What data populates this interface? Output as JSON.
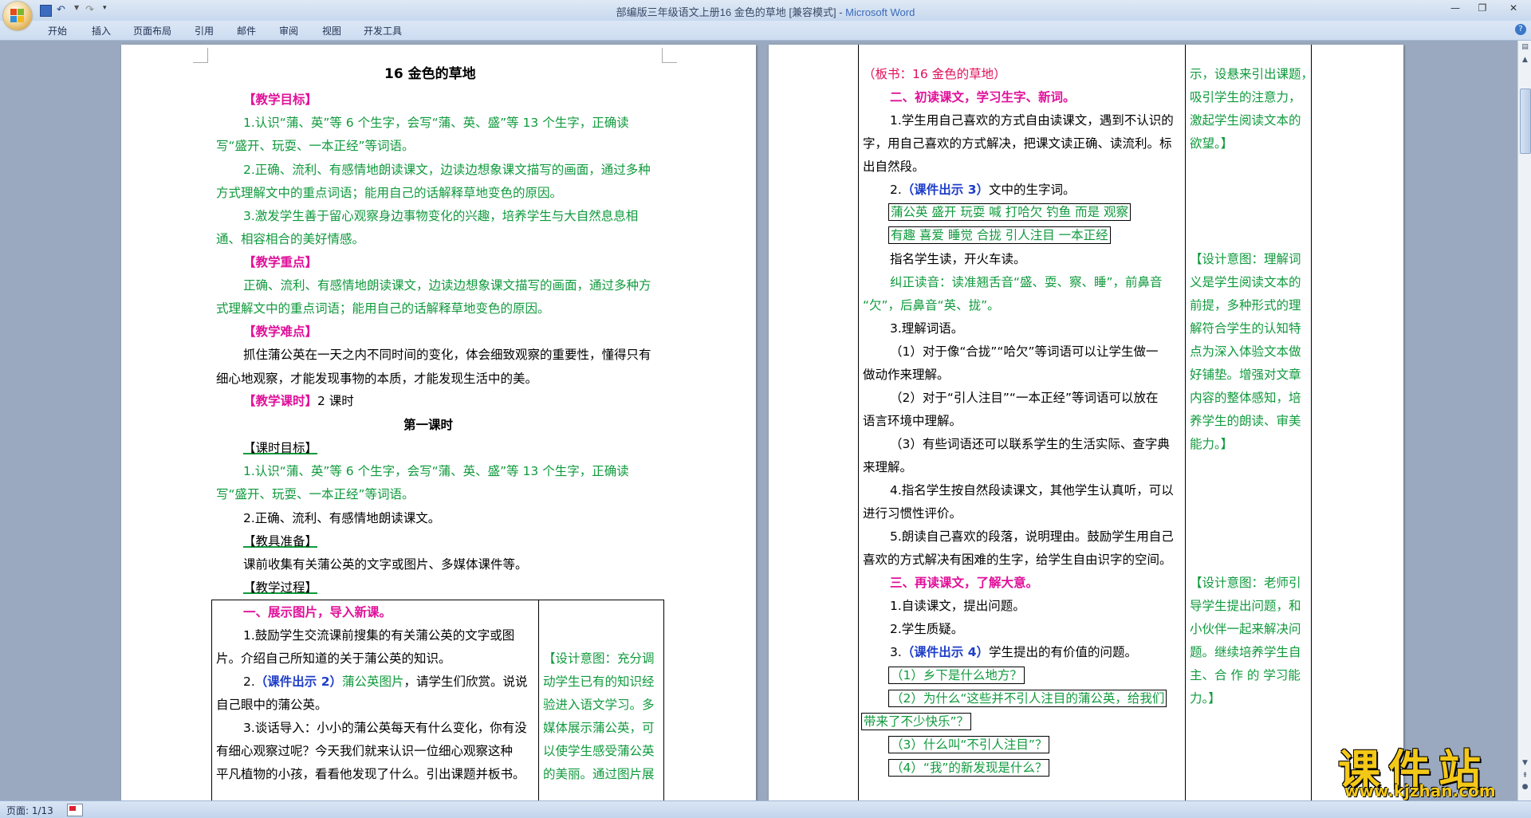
{
  "window": {
    "title": "部编版三年级语文上册16 金色的草地 [兼容模式]",
    "app_name": "Microsoft Word",
    "separator": " - "
  },
  "ribbon": {
    "tabs": [
      "开始",
      "插入",
      "页面布局",
      "引用",
      "邮件",
      "审阅",
      "视图",
      "开发工具"
    ]
  },
  "status": {
    "page": "页面: 1/13"
  },
  "watermark": {
    "big": "课件站",
    "url": "www.kjzhan.com"
  },
  "colors": {
    "magenta": "#e0119a",
    "green": "#0f9a3c",
    "blue": "#1f3ec9",
    "red": "#e0115a"
  },
  "page1": {
    "title": "16 金色的草地",
    "h_goal": "【教学目标】",
    "goal1a": "1.认识“蒲、英”等 6 个生字，会写“蒲、英、盛”等 13 个生字，正确读",
    "goal1b": "写“盛开、玩耍、一本正经”等词语。",
    "goal2a": "2.正确、流利、有感情地朗读课文，边读边想象课文描写的画面，通过多种",
    "goal2b": "方式理解文中的重点词语；能用自己的话解释草地变色的原因。",
    "goal3a": "3.激发学生善于留心观察身边事物变化的兴趣，培养学生与大自然息息相",
    "goal3b": "通、相容相合的美好情感。",
    "h_key": "【教学重点】",
    "key_a": "正确、流利、有感情地朗读课文，边读边想象课文描写的画面，通过多种方",
    "key_b": "式理解文中的重点词语；能用自己的话解释草地变色的原因。",
    "h_diff": "【教学难点】",
    "diff_a": "抓住蒲公英在一天之内不同时间的变化，体会细致观察的重要性，懂得只有",
    "diff_b": "细心地观察，才能发现事物的本质，才能发现生活中的美。",
    "h_hours": "【教学课时】",
    "hours": "2 课时",
    "lesson1": "第一课时",
    "h_lgoal": "【课时目标】",
    "lgoal1a": "1.认识“蒲、英”等 6 个生字，会写“蒲、英、盛”等 13 个生字，正确读",
    "lgoal1b": "写“盛开、玩耍、一本正经”等词语。",
    "lgoal2": "2.正确、流利、有感情地朗读课文。",
    "h_prep": "【教具准备】",
    "prep": "课前收集有关蒲公英的文字或图片、多媒体课件等。",
    "h_proc": "【教学过程】",
    "t_head": "一、展示图片，导入新课。",
    "t_1a": "1.鼓励学生交流课前搜集的有关蒲公英的文字或图",
    "t_1b": "片。介绍自己所知道的关于蒲公英的知识。",
    "t_2pre": "2.",
    "t_2blue": "（课件出示 2）",
    "t_2grn": "蒲公英图片",
    "t_2post": "，请学生们欣赏。说说",
    "t_2b": "自己眼中的蒲公英。",
    "t_3a": "3.谈话导入：小小的蒲公英每天有什么变化，你有没",
    "t_3b": "有细心观察过呢？今天我们就来认识一位细心观察这种",
    "t_3c": "平凡植物的小孩，看看他发现了什么。引出课题并板书。",
    "side1": "【设计意图：充分调",
    "side2": "动学生已有的知识经",
    "side3": "验进入语文学习。多",
    "side4": "媒体展示蒲公英，可",
    "side5": "以使学生感受蒲公英",
    "side6": "的美丽。通过图片展"
  },
  "page2": {
    "board": "（板书：16 金色的草地）",
    "h2": "二、初读课文，学习生字、新词。",
    "p1a": "1.学生用自己喜欢的方式自由读课文，遇到不认识的",
    "p1b": "字，用自己喜欢的方式解决，把课文读正确、读流利。标",
    "p1c": "出自然段。",
    "p2pre": "2.",
    "p2blue": "（课件出示 3）",
    "p2post": "文中的生字词。",
    "words1": "蒲公英 盛开 玩耍 喊 打哈欠 钓鱼 而是 观察",
    "words2": "有趣 喜爱 睡觉 合拢 引人注目 一本正经",
    "p_read": "指名学生读，开火车读。",
    "corr_a": "纠正读音：读准翘舌音“盛、耍、察、睡”，前鼻音",
    "corr_b": "“欠”，后鼻音“英、拢”。",
    "p3": "3.理解词语。",
    "p3_1a": "（1）对于像“合拢”“哈欠”等词语可以让学生做一",
    "p3_1b": "做动作来理解。",
    "p3_2a": "（2）对于“引人注目”“一本正经”等词语可以放在",
    "p3_2b": "语言环境中理解。",
    "p3_3a": "（3）有些词语还可以联系学生的生活实际、查字典",
    "p3_3b": "来理解。",
    "p4a": "4.指名学生按自然段读课文，其他学生认真听，可以",
    "p4b": "进行习惯性评价。",
    "p5a": "5.朗读自己喜欢的段落，说明理由。鼓励学生用自己",
    "p5b": "喜欢的方式解决有困难的生字，给学生自由识字的空间。",
    "h3": "三、再读课文，了解大意。",
    "q1": "1.自读课文，提出问题。",
    "q2": "2.学生质疑。",
    "q3pre": "3.",
    "q3blue": "（课件出示 4）",
    "q3post": "学生提出的有价值的问题。",
    "qa": "（1）乡下是什么地方？",
    "qb1": "（2）为什么“这些并不引人注目的蒲公英，给我们",
    "qb2": "带来了不少快乐”？",
    "qc": "（3）什么叫“不引人注目”？",
    "qd": "（4）“我”的新发现是什么？",
    "r1": "示，设悬来引出课题，",
    "r2": "吸引学生的注意力，",
    "r3": "激起学生阅读文本的",
    "r4": "欲望。】",
    "r5": "【设计意图：理解词",
    "r6": "义是学生阅读文本的",
    "r7": "前提，多种形式的理",
    "r8": "解符合学生的认知特",
    "r9": "点为深入体验文本做",
    "r10": "好铺垫。增强对文章",
    "r11": "内容的整体感知，培",
    "r12": "养学生的朗读、审美",
    "r13": "能力。】",
    "r14": "【设计意图：老师引",
    "r15": "导学生提出问题，和",
    "r16": "小伙伴一起来解决问",
    "r17": "题。继续培养学生自",
    "r18": "主、合 作 的 学习能",
    "r19": "力。】"
  }
}
